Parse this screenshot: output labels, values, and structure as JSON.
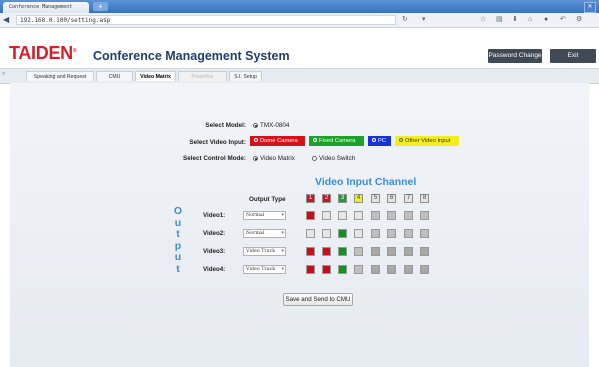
{
  "browser": {
    "tab_title": "Conference Management System",
    "url": "192.168.0.100/setting.asp",
    "new_tab_label": "+"
  },
  "header": {
    "logo": "TAIDEN",
    "title": "Conference Management System",
    "password_button": "Password Change",
    "exit_button": "Exit"
  },
  "tabs": [
    {
      "label": "Speaking and Request List",
      "state": "normal"
    },
    {
      "label": "CMU Setting",
      "state": "normal"
    },
    {
      "label": "Video Matrix",
      "state": "active"
    },
    {
      "label": "Predefine Position",
      "state": "disabled"
    },
    {
      "label": "S.I. Setup",
      "state": "normal"
    }
  ],
  "form": {
    "model_label": "Select Model:",
    "model_value": "TMX-0804",
    "input_label": "Select Video Input:",
    "inputs": [
      {
        "label": "Dome Camera",
        "color": "#d4121b"
      },
      {
        "label": "Fixed Camera",
        "color": "#1aa22a"
      },
      {
        "label": "PC",
        "color": "#1533d8"
      },
      {
        "label": "Other Video Input",
        "color": "#f3ee20"
      }
    ],
    "mode_label": "Select Control Mode:",
    "modes": [
      {
        "label": "Video Matrix",
        "checked": true
      },
      {
        "label": "Video Switch",
        "checked": false
      }
    ]
  },
  "matrix": {
    "title": "Video Input Channel",
    "output_type_label": "Output Type",
    "output_vertical": [
      "O",
      "u",
      "t",
      "p",
      "u",
      "t"
    ],
    "channel_numbers": [
      "1",
      "2",
      "3",
      "4",
      "5",
      "6",
      "7",
      "8"
    ],
    "channel_colors": [
      "#d4121b",
      "#d4121b",
      "#1aa22a",
      "#f3ee20",
      "#e3e3e3",
      "#e3e3e3",
      "#e3e3e3",
      "#e3e3e3"
    ],
    "rows": [
      {
        "label": "Video1:",
        "type": "Normal",
        "cells": [
          "#c41018",
          "#e6e6e6",
          "#e6e6e6",
          "#e6e6e6",
          "#bfbfbf",
          "#bfbfbf",
          "#bfbfbf",
          "#bfbfbf"
        ]
      },
      {
        "label": "Video2:",
        "type": "Normal",
        "cells": [
          "#e6e6e6",
          "#e6e6e6",
          "#168f22",
          "#e6e6e6",
          "#bfbfbf",
          "#bfbfbf",
          "#bfbfbf",
          "#bfbfbf"
        ]
      },
      {
        "label": "Video3:",
        "type": "Video Track",
        "cells": [
          "#c41018",
          "#c41018",
          "#168f22",
          "#bfbfbf",
          "#a8a8a8",
          "#a8a8a8",
          "#a8a8a8",
          "#a8a8a8"
        ]
      },
      {
        "label": "Video4:",
        "type": "Video Track",
        "cells": [
          "#c41018",
          "#c41018",
          "#168f22",
          "#bfbfbf",
          "#a8a8a8",
          "#a8a8a8",
          "#a8a8a8",
          "#a8a8a8"
        ]
      }
    ],
    "save_button": "Save and Send to CMU"
  }
}
